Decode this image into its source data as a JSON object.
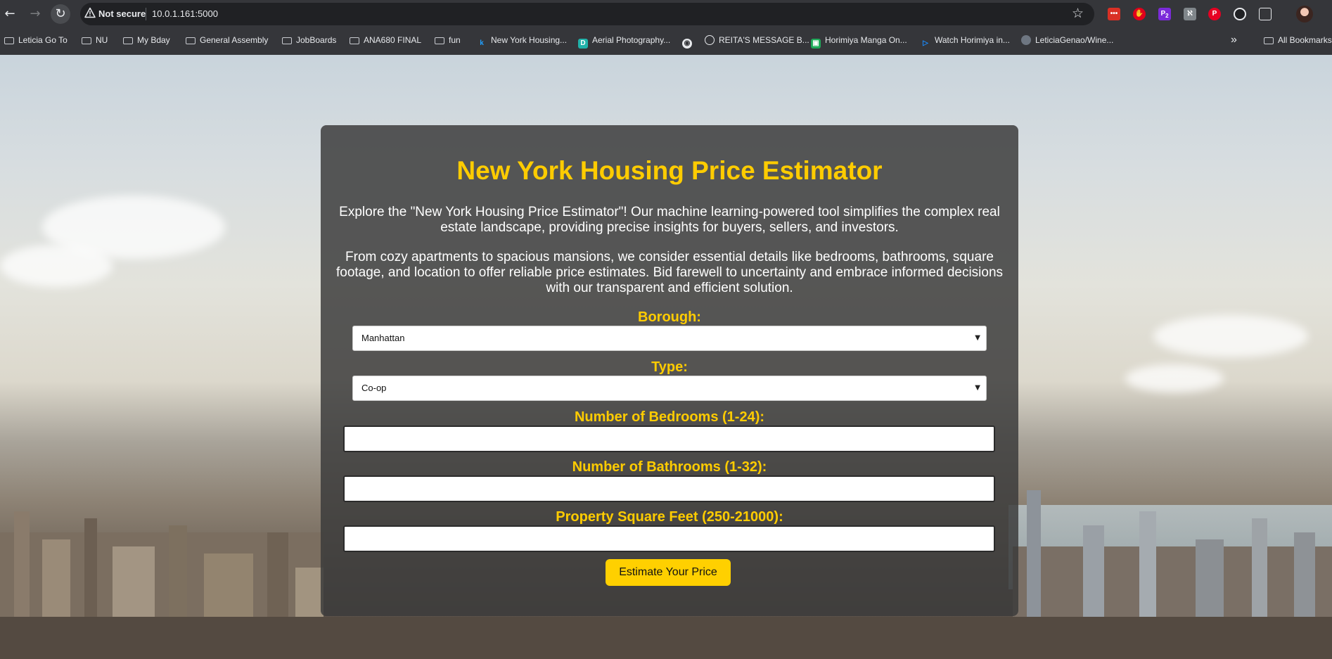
{
  "browser": {
    "security_label": "Not secure",
    "url": "10.0.1.161:5000",
    "bookmarks": [
      {
        "label": "Leticia Go To",
        "type": "folder"
      },
      {
        "label": "NU",
        "type": "folder"
      },
      {
        "label": "My Bday",
        "type": "folder"
      },
      {
        "label": "General Assembly",
        "type": "folder"
      },
      {
        "label": "JobBoards",
        "type": "folder"
      },
      {
        "label": "ANA680 FINAL",
        "type": "folder"
      },
      {
        "label": "fun",
        "type": "folder"
      },
      {
        "label": "New York Housing...",
        "type": "site"
      },
      {
        "label": "Aerial Photography...",
        "type": "site"
      },
      {
        "label": "REITA'S MESSAGE B...",
        "type": "site"
      },
      {
        "label": "Horimiya Manga On...",
        "type": "site"
      },
      {
        "label": "Watch Horimiya in...",
        "type": "site"
      },
      {
        "label": "LeticiaGenao/Wine...",
        "type": "site"
      }
    ],
    "all_bookmarks": "All Bookmarks",
    "more_bookmarks": "»",
    "extension_badge": "2",
    "accent_color": "#ffcc00"
  },
  "page": {
    "title": "New York Housing Price Estimator",
    "intro": "Explore the \"New York Housing Price Estimator\"! Our machine learning-powered tool simplifies the complex real estate landscape, providing precise insights for buyers, sellers, and investors.",
    "details": "From cozy apartments to spacious mansions, we consider essential details like bedrooms, bathrooms, square footage, and location to offer reliable price estimates. Bid farewell to uncertainty and embrace informed decisions with our transparent and efficient solution.",
    "form": {
      "borough_label": "Borough:",
      "borough_value": "Manhattan",
      "type_label": "Type:",
      "type_value": "Co-op",
      "bedrooms_label": "Number of Bedrooms (1-24):",
      "bedrooms_value": "",
      "bathrooms_label": "Number of Bathrooms (1-32):",
      "bathrooms_value": "",
      "sqft_label": "Property Square Feet (250-21000):",
      "sqft_value": "",
      "submit_label": "Estimate Your Price"
    }
  }
}
